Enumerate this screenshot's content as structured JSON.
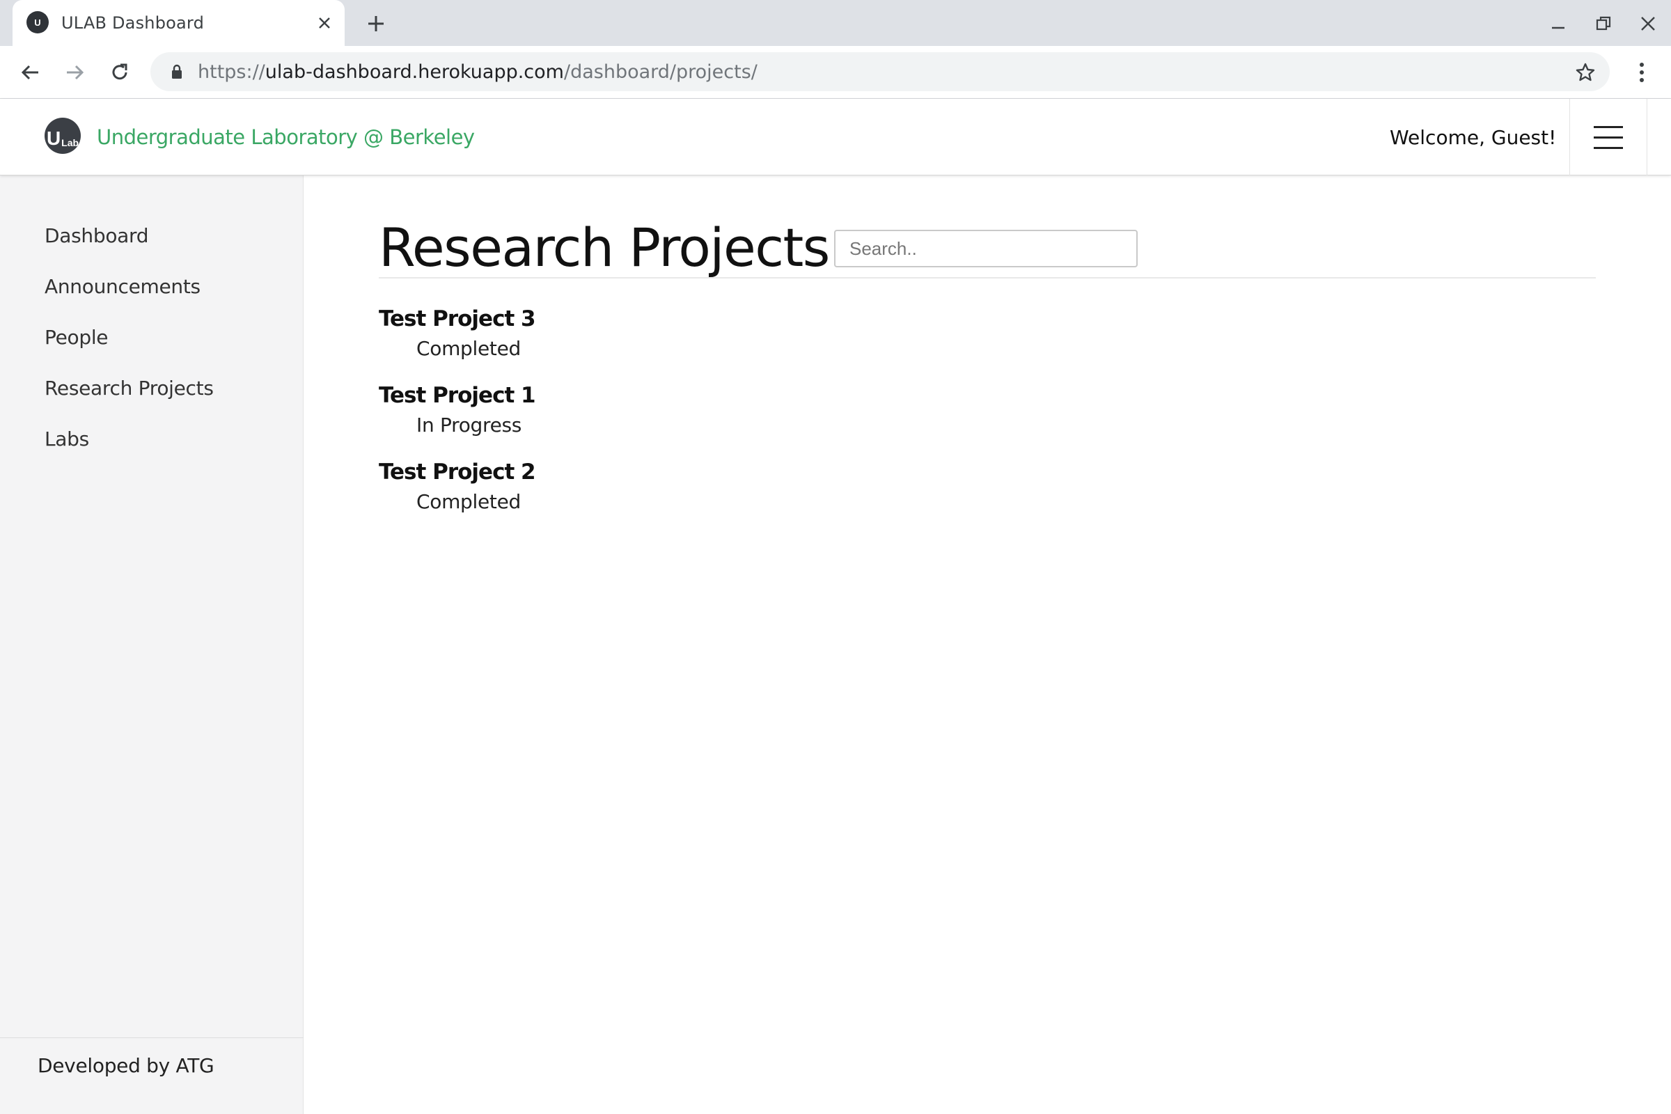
{
  "browser": {
    "tab_title": "ULAB Dashboard",
    "url_scheme": "https://",
    "url_host": "ulab-dashboard.herokuapp.com",
    "url_path": "/dashboard/projects/",
    "icons": [
      "close-icon",
      "plus-icon",
      "minimize-icon",
      "restore-icon",
      "window-close-icon",
      "back-arrow-icon",
      "forward-arrow-icon",
      "reload-icon",
      "lock-icon",
      "star-icon",
      "kebab-menu-icon"
    ]
  },
  "header": {
    "logo_text_big": "U",
    "logo_text_small": "Lab",
    "brand": "Undergraduate Laboratory @ Berkeley",
    "welcome": "Welcome, Guest!",
    "brand_color": "#3aa764"
  },
  "sidebar": {
    "items": [
      {
        "label": "Dashboard"
      },
      {
        "label": "Announcements"
      },
      {
        "label": "People"
      },
      {
        "label": "Research Projects"
      },
      {
        "label": "Labs"
      }
    ],
    "footer": "Developed by ATG"
  },
  "main": {
    "title": "Research Projects",
    "search_placeholder": "Search..",
    "projects": [
      {
        "name": "Test Project 3",
        "status": "Completed"
      },
      {
        "name": "Test Project 1",
        "status": "In Progress"
      },
      {
        "name": "Test Project 2",
        "status": "Completed"
      }
    ]
  }
}
